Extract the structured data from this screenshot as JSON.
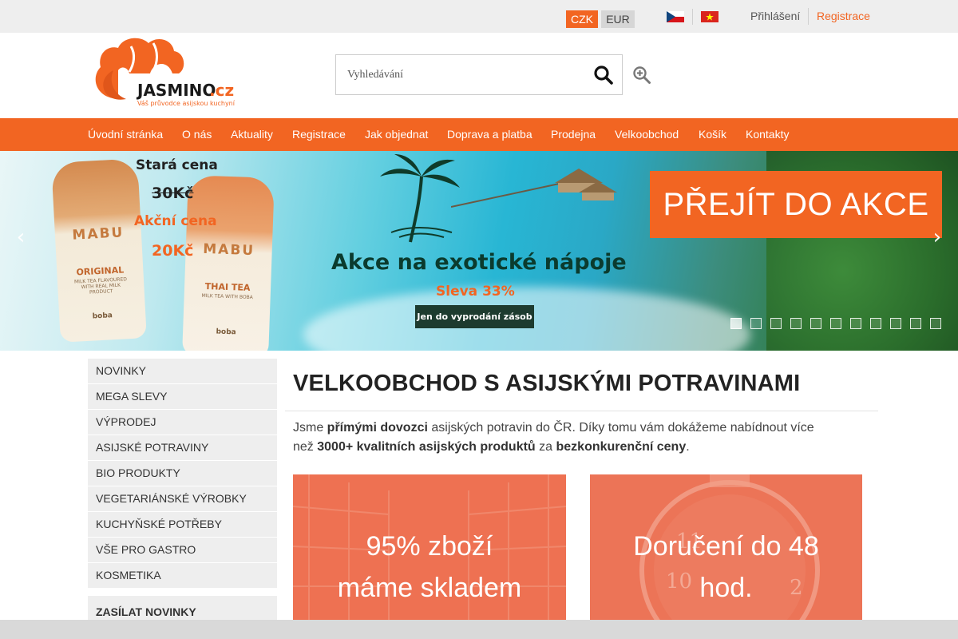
{
  "topbar": {
    "currencies": [
      "CZK",
      "EUR"
    ],
    "active_currency": "CZK",
    "languages": [
      "cs-flag-icon",
      "vn-flag-icon"
    ],
    "login_label": "Přihlášení",
    "register_label": "Registrace"
  },
  "header": {
    "logo_text": "JASMINO.cz",
    "logo_tagline": "Váš průvodce asijskou kuchyní",
    "search": {
      "placeholder": "Vyhledávání",
      "value": ""
    },
    "search_icon": "search-icon",
    "advanced_search_icon": "zoom-in-icon"
  },
  "nav": {
    "items": [
      "Úvodní stránka",
      "O nás",
      "Aktuality",
      "Registrace",
      "Jak objednat",
      "Doprava a platba",
      "Prodejna",
      "Velkoobchod",
      "Košík",
      "Kontakty"
    ]
  },
  "banner": {
    "bottles": [
      {
        "brand": "MABU",
        "name": "ORIGINAL",
        "sub": "MILK TEA FLAVOURED WITH REAL MILK PRODUCT",
        "boba": "boba"
      },
      {
        "brand": "MABU",
        "name": "THAI TEA",
        "sub": "MILK TEA WITH BOBA",
        "boba": "boba"
      }
    ],
    "old_price_label": "Stará cena",
    "old_price": "30Kč",
    "new_price_label": "Akční cena",
    "new_price": "20Kč",
    "title": "Akce na exotické nápoje",
    "discount": "Sleva 33%",
    "until": "Jen do vyprodání zásob",
    "cta": "PŘEJÍT DO AKCE",
    "prev_icon": "chevron-left-icon",
    "next_icon": "chevron-right-icon",
    "slide_count": 11,
    "active_slide": 1
  },
  "sidebar": {
    "categories": [
      "NOVINKY",
      "MEGA SLEVY",
      "VÝPRODEJ",
      "ASIJSKÉ POTRAVINY",
      "BIO PRODUKTY",
      "VEGETARIÁNSKÉ VÝROBKY",
      "KUCHYŇSKÉ POTŘEBY",
      "VŠE PRO GASTRO",
      "KOSMETIKA"
    ],
    "newsletter_label": "ZASÍLAT NOVINKY"
  },
  "main": {
    "title": "VELKOOBCHOD S ASIJSKÝMI POTRAVINAMI",
    "intro": {
      "p1": "Jsme ",
      "b1": "přímými dovozci",
      "p2": " asijských potravin do ČR. Díky tomu vám dokážeme nabídnout více než ",
      "b2": "3000+ kvalitních asijských produktů",
      "p3": " za ",
      "b3": "bezkonkurenční ceny",
      "p4": "."
    },
    "tiles": [
      {
        "line1": "95% zboží",
        "line2": "máme skladem"
      },
      {
        "line1": "Doručení do 48",
        "line2": "hod."
      }
    ]
  },
  "colors": {
    "accent": "#f26522",
    "topbar_bg": "#eeeeee",
    "sidebar_bg": "#eeeeee",
    "tile_overlay": "#ee6f4f"
  }
}
